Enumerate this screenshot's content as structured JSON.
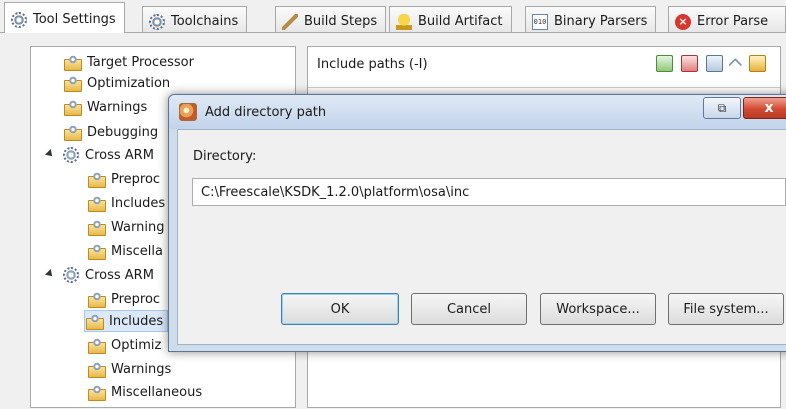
{
  "tabs": [
    {
      "label": "Tool Settings",
      "active": true,
      "icon": "gear-icon"
    },
    {
      "label": "Toolchains",
      "active": false,
      "icon": "gear-icon"
    },
    {
      "label": "Build Steps",
      "active": false,
      "icon": "brush-icon"
    },
    {
      "label": "Build Artifact",
      "active": false,
      "icon": "trophy-icon"
    },
    {
      "label": "Binary Parsers",
      "active": false,
      "icon": "binary-icon"
    },
    {
      "label": "Error Parse",
      "active": false,
      "icon": "error-icon"
    }
  ],
  "tree": {
    "items": [
      {
        "label": "Target Processor",
        "selected": false
      },
      {
        "label": "Optimization",
        "selected": false
      },
      {
        "label": "Warnings",
        "selected": false
      },
      {
        "label": "Debugging",
        "selected": false
      },
      {
        "label": "Cross ARM",
        "selected": false,
        "expanded": true
      },
      {
        "label": "Preproc",
        "selected": false
      },
      {
        "label": "Includes",
        "selected": false
      },
      {
        "label": "Warning",
        "selected": false
      },
      {
        "label": "Miscella",
        "selected": false
      },
      {
        "label": "Cross ARM",
        "selected": false,
        "expanded": true
      },
      {
        "label": "Preproc",
        "selected": false
      },
      {
        "label": "Includes",
        "selected": true
      },
      {
        "label": "Optimiz",
        "selected": false
      },
      {
        "label": "Warnings",
        "selected": false
      },
      {
        "label": "Miscellaneous",
        "selected": false
      }
    ]
  },
  "include_panel": {
    "title": "Include paths (-I)",
    "toolbar_icons": [
      "add-icon",
      "delete-icon",
      "edit-icon",
      "move-up-icon",
      "move-down-icon"
    ]
  },
  "dialog": {
    "title": "Add directory path",
    "directory_label": "Directory:",
    "directory_value": "C:\\Freescale\\KSDK_1.2.0\\platform\\osa\\inc",
    "buttons": {
      "ok": "OK",
      "cancel": "Cancel",
      "workspace": "Workspace...",
      "file_system": "File system..."
    },
    "close_glyph": "x"
  },
  "colors": {
    "selection": "#dbe8f7",
    "close_button": "#d24a32",
    "dialog_frame": "#cfdcea"
  }
}
